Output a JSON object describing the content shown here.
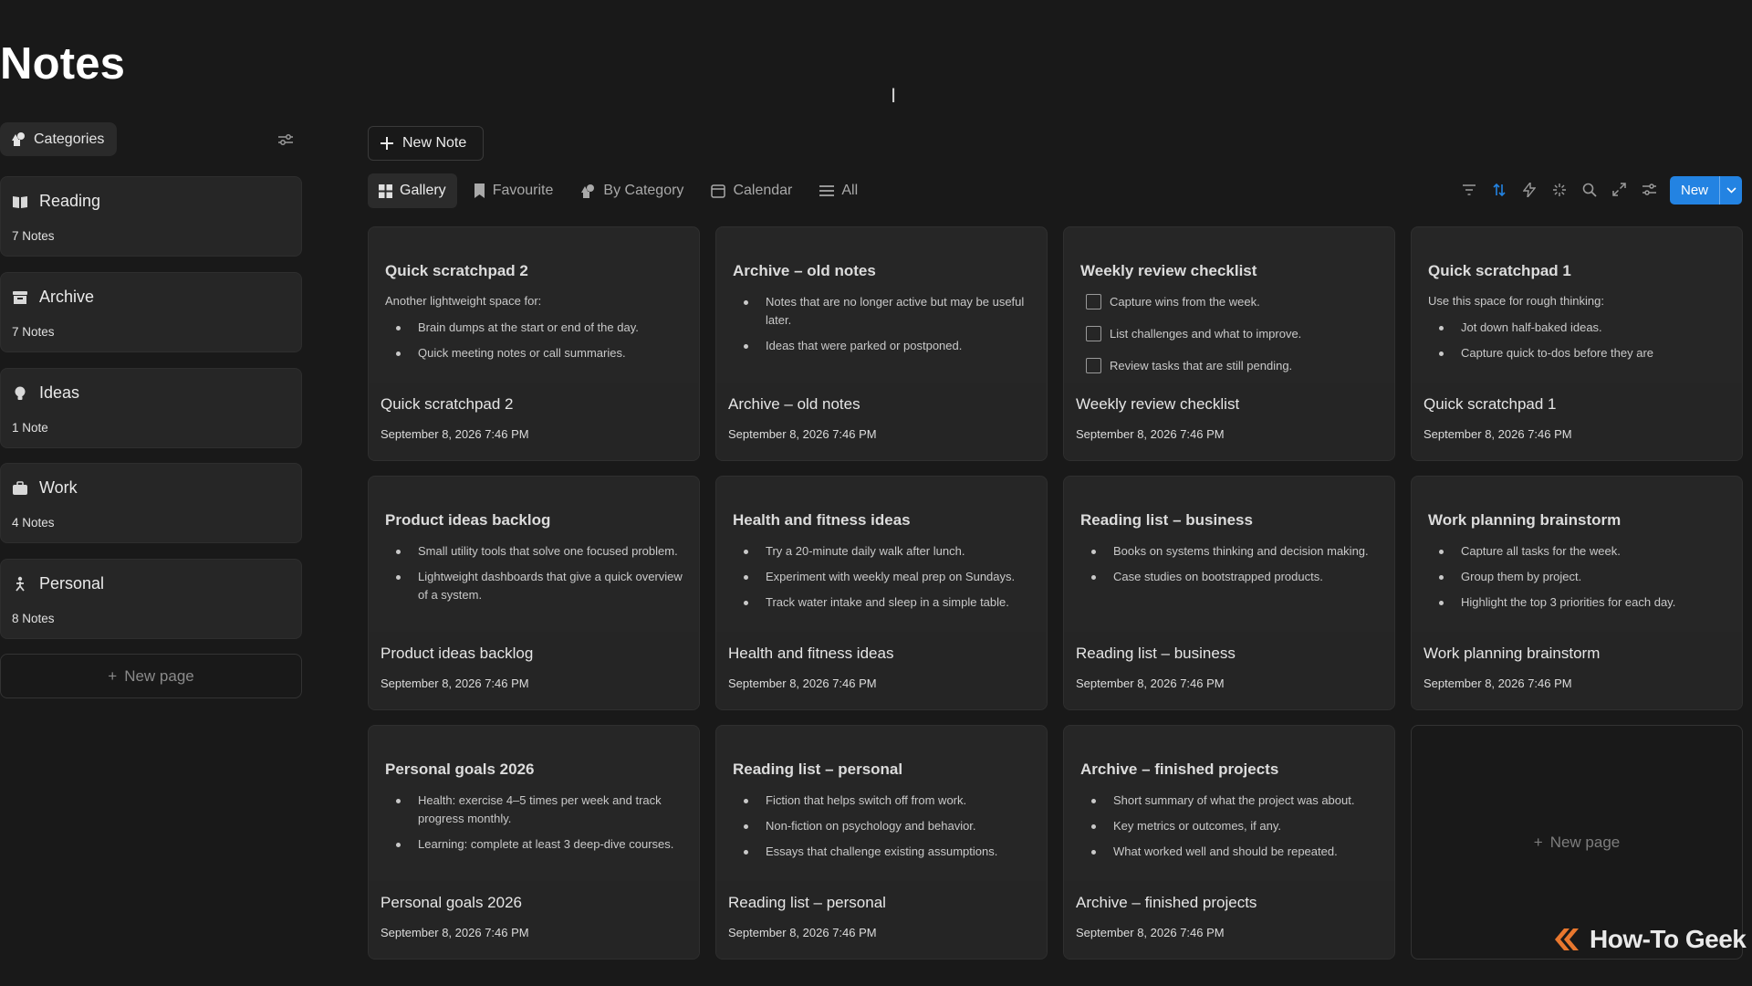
{
  "page": {
    "title": "Notes"
  },
  "sidebar": {
    "categories_label": "Categories",
    "items": [
      {
        "label": "Reading",
        "count": "7 Notes",
        "icon": "book-icon"
      },
      {
        "label": "Archive",
        "count": "7 Notes",
        "icon": "archive-icon"
      },
      {
        "label": "Ideas",
        "count": "1 Note",
        "icon": "lightbulb-icon"
      },
      {
        "label": "Work",
        "count": "4 Notes",
        "icon": "briefcase-icon"
      },
      {
        "label": "Personal",
        "count": "8 Notes",
        "icon": "person-icon"
      }
    ],
    "new_page_label": "New page"
  },
  "toolbar": {
    "new_note_label": "New Note",
    "tabs": [
      {
        "label": "Gallery",
        "icon": "grid-icon",
        "active": true
      },
      {
        "label": "Favourite",
        "icon": "bookmark-icon",
        "active": false
      },
      {
        "label": "By Category",
        "icon": "shapes-icon",
        "active": false
      },
      {
        "label": "Calendar",
        "icon": "calendar-icon",
        "active": false
      },
      {
        "label": "All",
        "icon": "list-icon",
        "active": false
      }
    ],
    "tools": [
      "filter-icon",
      "sort-icon",
      "lightning-icon",
      "sparkle-icon",
      "search-icon",
      "expand-icon",
      "settings-icon"
    ],
    "new_button_label": "New",
    "accent_color": "#2383e2"
  },
  "cards": [
    {
      "preview_title": "Quick scratchpad 2",
      "intro": "Another lightweight space for:",
      "items": [
        "Brain dumps at the start or end of the day.",
        "Quick meeting notes or call summaries."
      ],
      "title": "Quick scratchpad 2",
      "date": "September 8, 2026 7:46 PM"
    },
    {
      "preview_title": "Archive – old notes",
      "items": [
        "Notes that are no longer active but may be useful later.",
        "Ideas that were parked or postponed."
      ],
      "title": "Archive – old notes",
      "date": "September 8, 2026 7:46 PM"
    },
    {
      "preview_title": "Weekly review checklist",
      "tasks": [
        "Capture wins from the week.",
        "List challenges and what to improve.",
        "Review tasks that are still pending."
      ],
      "title": "Weekly review checklist",
      "date": "September 8, 2026 7:46 PM"
    },
    {
      "preview_title": "Quick scratchpad 1",
      "intro": "Use this space for rough thinking:",
      "items": [
        "Jot down half-baked ideas.",
        "Capture quick to-dos before they are"
      ],
      "title": "Quick scratchpad 1",
      "date": "September 8, 2026 7:46 PM"
    },
    {
      "preview_title": "Product ideas backlog",
      "items": [
        "Small utility tools that solve one focused problem.",
        "Lightweight dashboards that give a quick overview of a system."
      ],
      "title": "Product ideas backlog",
      "date": "September 8, 2026 7:46 PM"
    },
    {
      "preview_title": "Health and fitness ideas",
      "items": [
        "Try a 20-minute daily walk after lunch.",
        "Experiment with weekly meal prep on Sundays.",
        "Track water intake and sleep in a simple table."
      ],
      "title": "Health and fitness ideas",
      "date": "September 8, 2026 7:46 PM"
    },
    {
      "preview_title": "Reading list – business",
      "items": [
        "Books on systems thinking and decision making.",
        "Case studies on bootstrapped products."
      ],
      "title": "Reading list – business",
      "date": "September 8, 2026 7:46 PM"
    },
    {
      "preview_title": "Work planning brainstorm",
      "items": [
        "Capture all tasks for the week.",
        "Group them by project.",
        "Highlight the top 3 priorities for each day."
      ],
      "title": "Work planning brainstorm",
      "date": "September 8, 2026 7:46 PM"
    },
    {
      "preview_title": "Personal goals 2026",
      "items": [
        "Health: exercise 4–5 times per week and track progress monthly.",
        "Learning: complete at least 3 deep-dive courses."
      ],
      "title": "Personal goals 2026",
      "date": "September 8, 2026 7:46 PM"
    },
    {
      "preview_title": "Reading list – personal",
      "items": [
        "Fiction that helps switch off from work.",
        "Non-fiction on psychology and behavior.",
        "Essays that challenge existing assumptions."
      ],
      "title": "Reading list – personal",
      "date": "September 8, 2026 7:46 PM"
    },
    {
      "preview_title": "Archive – finished projects",
      "items": [
        "Short summary of what the project was about.",
        "Key metrics or outcomes, if any.",
        "What worked well and should be repeated."
      ],
      "title": "Archive – finished projects",
      "date": "September 8, 2026 7:46 PM"
    }
  ],
  "gallery_new_page_label": "New page",
  "watermark": {
    "text": "How-To Geek",
    "color": "#e8772e"
  }
}
